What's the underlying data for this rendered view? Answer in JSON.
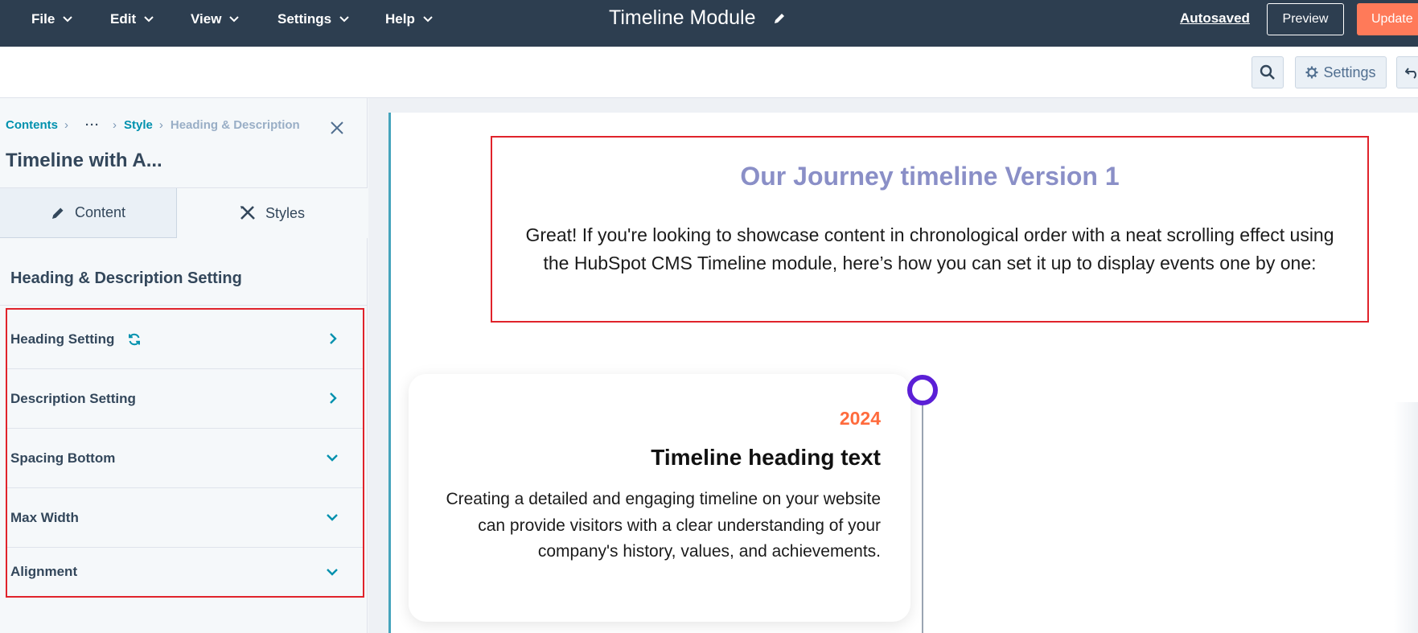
{
  "topbar": {
    "menus": [
      "File",
      "Edit",
      "View",
      "Settings",
      "Help"
    ],
    "title": "Timeline Module",
    "autosaved": "Autosaved",
    "preview": "Preview",
    "update": "Update"
  },
  "toolbar": {
    "settings": "Settings"
  },
  "sidebar": {
    "breadcrumb": {
      "root": "Contents",
      "ellipsis": "···",
      "parent": "Style",
      "current": "Heading & Description"
    },
    "title": "Timeline with A...",
    "tabs": {
      "content": "Content",
      "styles": "Styles",
      "active": "Styles"
    },
    "section_heading": "Heading & Description Setting",
    "items": [
      {
        "label": "Heading Setting",
        "icon": "chevron-right-icon",
        "has_sync": true
      },
      {
        "label": "Description Setting",
        "icon": "chevron-right-icon"
      },
      {
        "label": "Spacing Bottom",
        "icon": "chevron-down-icon"
      },
      {
        "label": "Max Width",
        "icon": "chevron-down-icon"
      },
      {
        "label": "Alignment",
        "icon": "chevron-down-icon"
      }
    ]
  },
  "preview": {
    "intro_title": "Our Journey timeline Version 1",
    "intro_description": "Great! If you're looking to showcase content in chronological order with a neat scrolling effect using the HubSpot CMS Timeline module, here’s how you can set it up to display events one by one:",
    "card": {
      "year": "2024",
      "heading": "Timeline heading text",
      "text": "Creating a detailed and engaging timeline on your website can provide visitors with a clear understanding of your company's history, values, and achievements."
    }
  },
  "colors": {
    "topbar": "#2d3e50",
    "accent_teal": "#0091ae",
    "update_orange": "#ff7a59",
    "highlight_red": "#e0232b",
    "intro_title": "#8a8fc7",
    "year": "#ff6b3d",
    "timeline_dot": "#5b1fd6"
  }
}
